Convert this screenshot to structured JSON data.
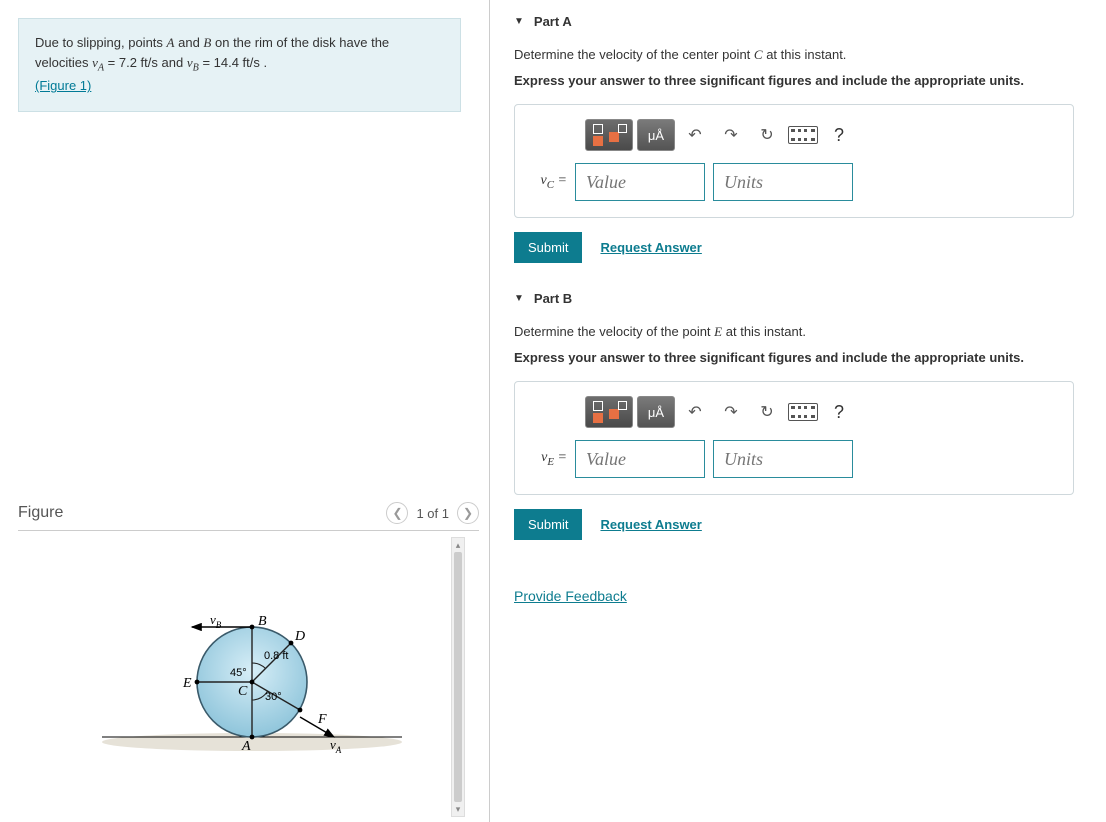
{
  "problem": {
    "prefix": "Due to slipping, points ",
    "point_a": "A",
    "mid1": " and ",
    "point_b": "B",
    "mid2": " on the rim of the disk have the velocities ",
    "va_sym": "v",
    "va_sub": "A",
    "va_eq": " = 7.2 ft/s",
    "and": " and ",
    "vb_sym": "v",
    "vb_sub": "B",
    "vb_eq": " = 14.4 ft/s .",
    "figure_link": "(Figure 1)"
  },
  "figure": {
    "title": "Figure",
    "pager": "1 of 1",
    "radius_label": "0.8 ft",
    "angle45": "45°",
    "angle30": "30°",
    "label_A": "A",
    "label_B": "B",
    "label_C": "C",
    "label_D": "D",
    "label_E": "E",
    "label_F": "F",
    "vA": "v",
    "vA_sub": "A",
    "vB": "v",
    "vB_sub": "B"
  },
  "part_a": {
    "title": "Part A",
    "question_prefix": "Determine the velocity of the center point ",
    "question_var": "C",
    "question_suffix": " at this instant.",
    "instruction": "Express your answer to three significant figures and include the appropriate units.",
    "var_label_sym": "v",
    "var_label_sub": "C",
    "eq": " =",
    "value_ph": "Value",
    "units_ph": "Units",
    "submit": "Submit",
    "request": "Request Answer",
    "mu": "μ",
    "angstrom": "Å"
  },
  "part_b": {
    "title": "Part B",
    "question_prefix": "Determine the velocity of the point ",
    "question_var": "E",
    "question_suffix": " at this instant.",
    "instruction": "Express your answer to three significant figures and include the appropriate units.",
    "var_label_sym": "v",
    "var_label_sub": "E",
    "eq": " =",
    "value_ph": "Value",
    "units_ph": "Units",
    "submit": "Submit",
    "request": "Request Answer",
    "mu": "μ",
    "angstrom": "Å"
  },
  "toolbar": {
    "help": "?"
  },
  "feedback": "Provide Feedback"
}
